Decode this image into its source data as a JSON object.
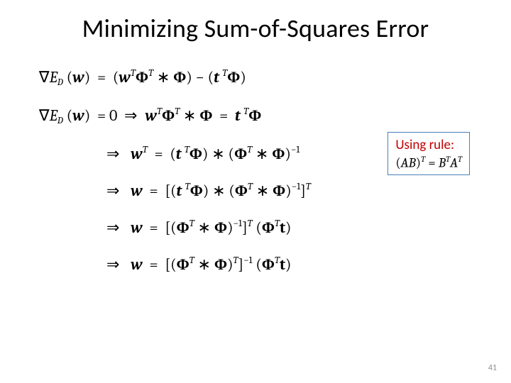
{
  "title": "Minimizing Sum-of-Squares Error",
  "slide_number": "41",
  "rule": {
    "label": "Using rule:",
    "lhs_open": "(",
    "lhs_A": "A",
    "lhs_B": "B",
    "lhs_close": ")",
    "rhs_eq": "= ",
    "rhs_B": "B",
    "rhs_A": "A",
    "sup_T": "T"
  },
  "sym": {
    "nabla": "∇",
    "E": "E",
    "D": "D",
    "w": "w",
    "t": "t",
    "Phi": "Φ",
    "T": "T",
    "star": " ∗ ",
    "impl": "⇒",
    "eq": "=",
    "zero": "0",
    "lpar": "(",
    "rpar": ")",
    "lbr": "[",
    "rbr": "]",
    "minus": " − ",
    "neg1": "−1"
  }
}
